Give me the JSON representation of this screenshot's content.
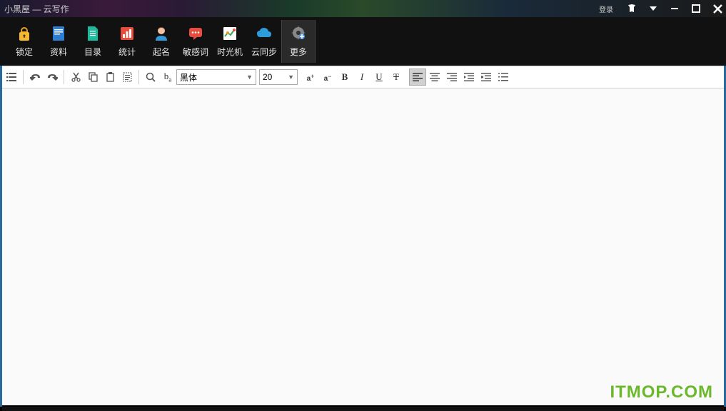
{
  "titlebar": {
    "title": "小黑屋 — 云写作",
    "login": "登录"
  },
  "mainToolbar": {
    "items": [
      {
        "label": "锁定"
      },
      {
        "label": "资料"
      },
      {
        "label": "目录"
      },
      {
        "label": "统计"
      },
      {
        "label": "起名"
      },
      {
        "label": "敏感词"
      },
      {
        "label": "时光机"
      },
      {
        "label": "云同步"
      },
      {
        "label": "更多"
      }
    ]
  },
  "editToolbar": {
    "font": "黑体",
    "fontSize": "20"
  },
  "watermark": "ITMOP.COM"
}
